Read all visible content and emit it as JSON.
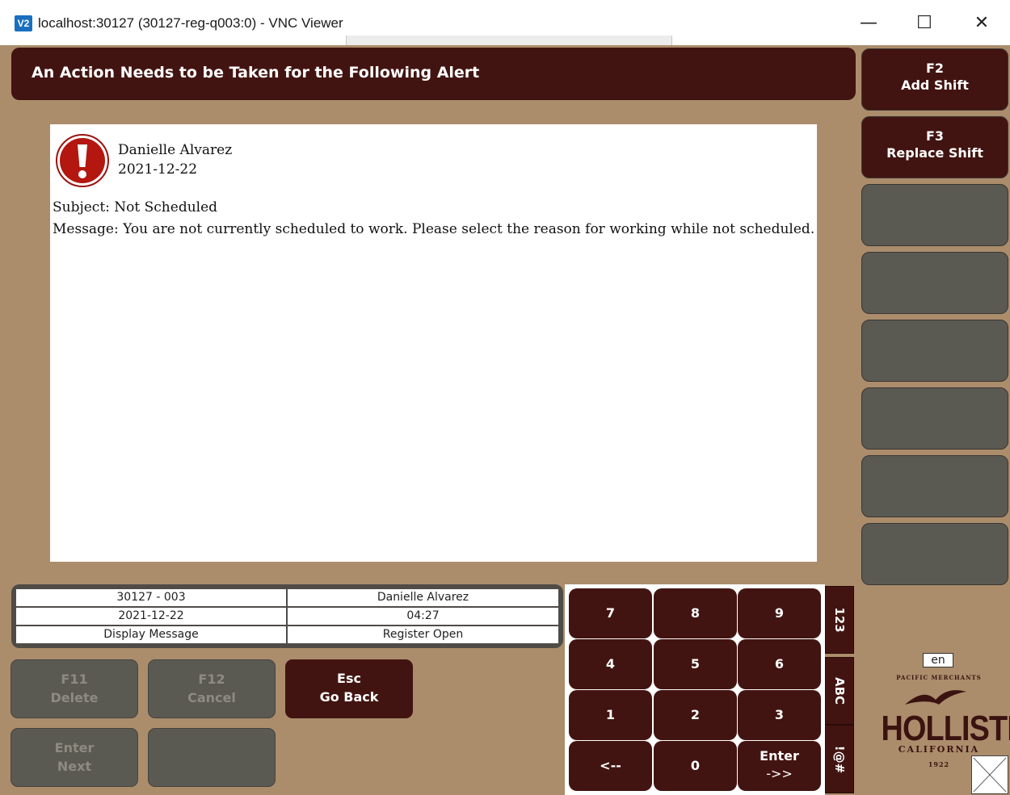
{
  "window": {
    "title": "localhost:30127 (30127-reg-q003:0) - VNC Viewer",
    "logo_text": "V2",
    "minimize_glyph": "—",
    "maximize_glyph": "☐",
    "close_glyph": "✕"
  },
  "header": {
    "title": "An Action Needs to be Taken for the Following Alert"
  },
  "function_keys": [
    {
      "key": "F2",
      "label": "Add Shift"
    },
    {
      "key": "F3",
      "label": "Replace Shift"
    }
  ],
  "alert": {
    "icon": "exclamation-icon",
    "name": "Danielle Alvarez",
    "date": "2021-12-22",
    "subject": "Subject: Not Scheduled",
    "message": "Message: You are not currently scheduled to work. Please select the reason for working while not scheduled."
  },
  "status": {
    "store_register": "30127 - 003",
    "employee": "Danielle Alvarez",
    "date": "2021-12-22",
    "time": "04:27",
    "mode": "Display Message",
    "register_state": "Register Open"
  },
  "buttons": {
    "f11_key": "F11",
    "f11_label": "Delete",
    "f12_key": "F12",
    "f12_label": "Cancel",
    "esc_key": "Esc",
    "esc_label": "Go Back",
    "enter_key": "Enter",
    "enter_label": "Next"
  },
  "keypad": {
    "keys": [
      "7",
      "8",
      "9",
      "4",
      "5",
      "6",
      "1",
      "2",
      "3",
      "<--",
      "0"
    ],
    "enter_l1": "Enter",
    "enter_l2": "->>",
    "modes": [
      "123",
      "ABC",
      "!@#"
    ]
  },
  "branding": {
    "language": "en",
    "tagline": "PACIFIC MERCHANTS",
    "name": "HOLLISTER",
    "region": "CALIFORNIA",
    "year": "1922"
  },
  "colors": {
    "accent": "#421411",
    "background": "#ab8d6c",
    "disabled": "#5b5a52"
  }
}
